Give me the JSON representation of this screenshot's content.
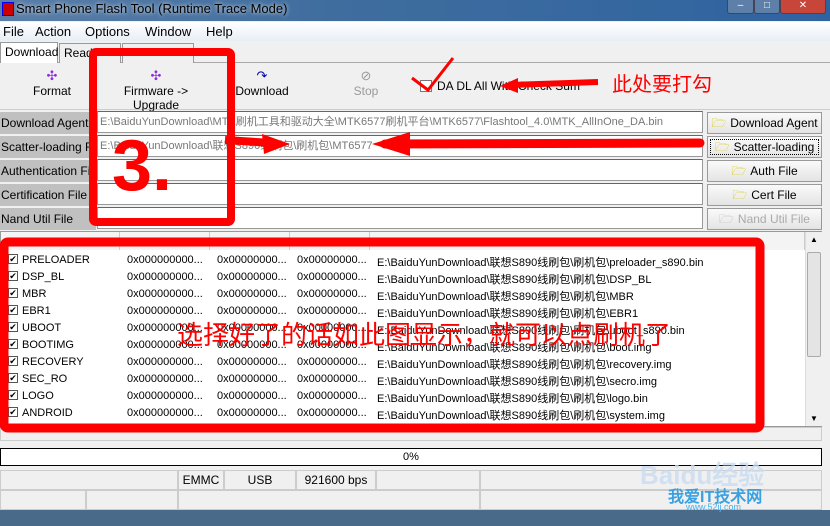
{
  "window": {
    "title": "Smart Phone Flash Tool (Runtime Trace Mode)",
    "min": "–",
    "max": "□",
    "close": "✕"
  },
  "menu": [
    "File",
    "Action",
    "Options",
    "Window",
    "Help"
  ],
  "tabs": [
    "Download",
    "Read"
  ],
  "toolbar": {
    "format": "Format",
    "firmware_upgrade": "Firmware -> Upgrade",
    "download": "Download",
    "stop": "Stop",
    "da_dl_all": "DA DL All With Check Sum",
    "da_dl_all_checked": true
  },
  "files": [
    {
      "label": "Download Agent",
      "value": "E:\\BaiduYunDownload\\MTK刷机工具和驱动大全\\MTK6577刷机平台\\MTK6577\\Flashtool_4.0\\MTK_AllInOne_DA.bin",
      "button": "Download Agent"
    },
    {
      "label": "Scatter-loading File",
      "value": "E:\\BaiduYunDownload\\联想S890线刷包\\刷机包\\MT6577",
      "button": "Scatter-loading"
    },
    {
      "label": "Authentication File",
      "value": "",
      "button": "Auth File"
    },
    {
      "label": "Certification File",
      "value": "",
      "button": "Cert File"
    },
    {
      "label": "Nand Util File",
      "value": "",
      "button": "Nand Util File"
    }
  ],
  "rows": [
    {
      "name": "PRELOADER",
      "a": "0x000000000...",
      "b": "0x00000000...",
      "c": "0x00000000...",
      "path": "E:\\BaiduYunDownload\\联想S890线刷包\\刷机包\\preloader_s890.bin"
    },
    {
      "name": "DSP_BL",
      "a": "0x000000000...",
      "b": "0x00000000...",
      "c": "0x00000000...",
      "path": "E:\\BaiduYunDownload\\联想S890线刷包\\刷机包\\DSP_BL"
    },
    {
      "name": "MBR",
      "a": "0x000000000...",
      "b": "0x00000000...",
      "c": "0x00000000...",
      "path": "E:\\BaiduYunDownload\\联想S890线刷包\\刷机包\\MBR"
    },
    {
      "name": "EBR1",
      "a": "0x000000000...",
      "b": "0x00000000...",
      "c": "0x00000000...",
      "path": "E:\\BaiduYunDownload\\联想S890线刷包\\刷机包\\EBR1"
    },
    {
      "name": "UBOOT",
      "a": "0x000000000...",
      "b": "0x00000000...",
      "c": "0x00000000...",
      "path": "E:\\BaiduYunDownload\\联想S890线刷包\\刷机包\\uboot_s890.bin"
    },
    {
      "name": "BOOTIMG",
      "a": "0x000000000...",
      "b": "0x00000000...",
      "c": "0x00000000...",
      "path": "E:\\BaiduYunDownload\\联想S890线刷包\\刷机包\\boot.img"
    },
    {
      "name": "RECOVERY",
      "a": "0x000000000...",
      "b": "0x00000000...",
      "c": "0x00000000...",
      "path": "E:\\BaiduYunDownload\\联想S890线刷包\\刷机包\\recovery.img"
    },
    {
      "name": "SEC_RO",
      "a": "0x000000000...",
      "b": "0x00000000...",
      "c": "0x00000000...",
      "path": "E:\\BaiduYunDownload\\联想S890线刷包\\刷机包\\secro.img"
    },
    {
      "name": "LOGO",
      "a": "0x000000000...",
      "b": "0x00000000...",
      "c": "0x00000000...",
      "path": "E:\\BaiduYunDownload\\联想S890线刷包\\刷机包\\logo.bin"
    },
    {
      "name": "ANDROID",
      "a": "0x000000000...",
      "b": "0x00000000...",
      "c": "0x00000000...",
      "path": "E:\\BaiduYunDownload\\联想S890线刷包\\刷机包\\system.img"
    }
  ],
  "progress": {
    "text": "0%",
    "value": 0
  },
  "status": {
    "storage": "EMMC",
    "port": "USB",
    "baud": "921600 bps"
  },
  "annotations": {
    "check_note": "此处要打勾",
    "step": "3.",
    "list_note": "选择好了的话如此图显示，就可以点刷机了",
    "accent": "#ff0000"
  },
  "watermark": {
    "brand": "Baidu经验",
    "site": "我爱IT技术网",
    "url": "www.52ij.com"
  }
}
